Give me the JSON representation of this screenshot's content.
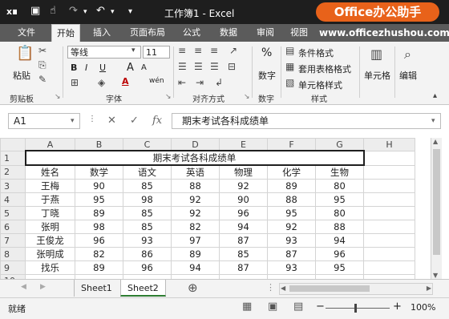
{
  "titlebar": {
    "title": "工作簿1 - Excel",
    "badge": "Office办公助手",
    "qa_icons": [
      "excel-logo-icon",
      "save-icon",
      "touch-mode-icon",
      "redo-icon",
      "undo-icon",
      "customize-qa-icon"
    ]
  },
  "tabs": [
    "文件",
    "开始",
    "插入",
    "页面布局",
    "公式",
    "数据",
    "审阅",
    "视图"
  ],
  "active_tab": "开始",
  "watermark": "www.officezhushou.com",
  "ribbon": {
    "clipboard": {
      "paste": "粘贴",
      "label": "剪贴板"
    },
    "font": {
      "name": "等线",
      "size": "11",
      "bold": "B",
      "italic": "I",
      "underline": "U",
      "grow": "A",
      "shrink": "A",
      "color": "A",
      "wen": "wén",
      "label": "字体"
    },
    "alignment": {
      "label": "对齐方式"
    },
    "number": {
      "symbol": "%",
      "label": "数字"
    },
    "styles": {
      "conditional": "条件格式",
      "table": "套用表格格式",
      "cell": "单元格样式",
      "label": "样式"
    },
    "cells": {
      "label": "单元格"
    },
    "editing": {
      "label": "编辑"
    }
  },
  "formula": {
    "namebox": "A1",
    "fx": "fx",
    "content": "期末考试各科成绩单"
  },
  "columns": [
    "A",
    "B",
    "C",
    "D",
    "E",
    "F",
    "G",
    "H"
  ],
  "rows": [
    "1",
    "2",
    "3",
    "4",
    "5",
    "6",
    "7",
    "8",
    "9",
    "10"
  ],
  "sheet": {
    "title": "期末考试各科成绩单",
    "headers": [
      "姓名",
      "数学",
      "语文",
      "英语",
      "物理",
      "化学",
      "生物"
    ],
    "data": [
      [
        "王梅",
        "90",
        "85",
        "88",
        "92",
        "89",
        "80"
      ],
      [
        "于燕",
        "95",
        "98",
        "92",
        "90",
        "88",
        "95"
      ],
      [
        "丁晓",
        "89",
        "85",
        "92",
        "96",
        "95",
        "80"
      ],
      [
        "张明",
        "98",
        "85",
        "82",
        "94",
        "92",
        "88"
      ],
      [
        "王俊龙",
        "96",
        "93",
        "97",
        "87",
        "93",
        "94"
      ],
      [
        "张明成",
        "82",
        "86",
        "89",
        "85",
        "87",
        "96"
      ],
      [
        "找乐",
        "89",
        "96",
        "94",
        "87",
        "93",
        "95"
      ]
    ]
  },
  "sheet_tabs": [
    "Sheet1",
    "Sheet2"
  ],
  "active_sheet": "Sheet2",
  "status": {
    "ready": "就绪",
    "zoom": "100%"
  }
}
